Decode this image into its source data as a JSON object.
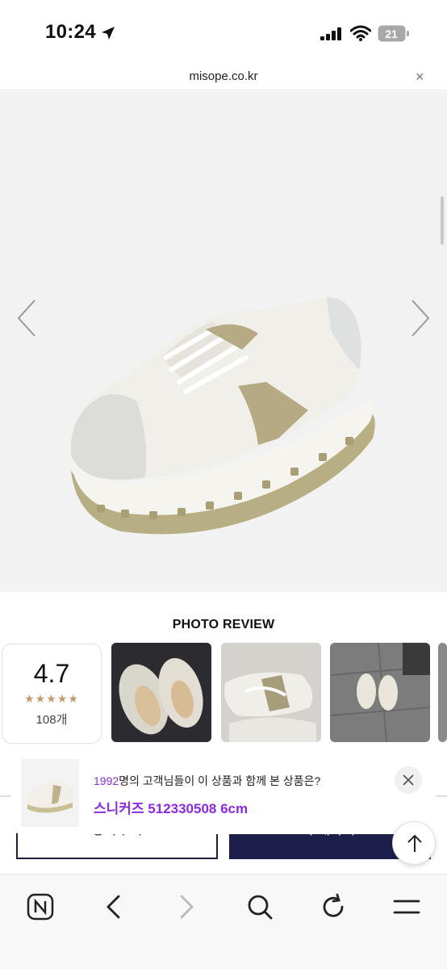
{
  "status_bar": {
    "time": "10:24",
    "battery": "21",
    "icons": [
      "location-arrow-icon",
      "signal-icon",
      "wifi-icon",
      "battery-icon"
    ]
  },
  "browser": {
    "url": "misope.co.kr",
    "close_label": "×"
  },
  "product": {
    "image": "sneaker-product-image",
    "nav": [
      "chevron-left-icon",
      "chevron-right-icon"
    ]
  },
  "photo_review": {
    "title": "PHOTO REVIEW",
    "rating": "4.7",
    "stars": "★★★★★",
    "count": "108개"
  },
  "recommendation": {
    "count": "1992",
    "text": "명의 고객님들이 이 상품과 함께 본 상품은?",
    "product": "스니커즈 512330508 6cm"
  },
  "actions": {
    "cart": "장바구니",
    "buy": "구매하기"
  },
  "toolbar": {
    "icons": [
      "naver-n-icon",
      "back-icon",
      "forward-icon",
      "search-icon",
      "reload-icon",
      "menu-icon"
    ]
  },
  "colors": {
    "brand_navy": "#1c1f4a",
    "accent_purple": "#8a2be2",
    "star": "#c59a6c"
  }
}
